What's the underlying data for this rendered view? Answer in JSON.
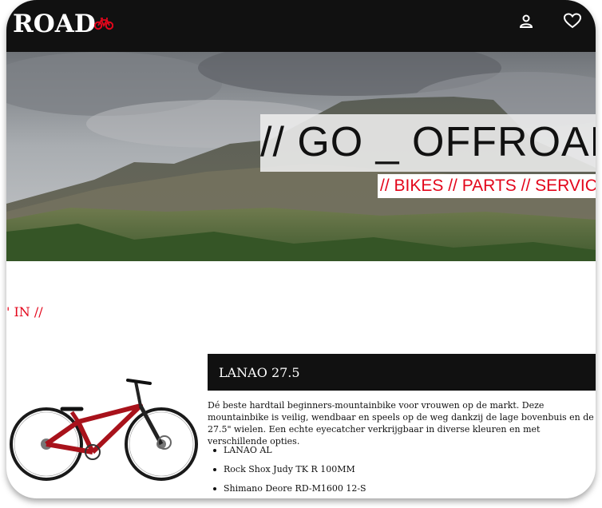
{
  "header": {
    "brand": "ROAD",
    "icons": [
      "bike-icon",
      "user-icon",
      "heart-icon"
    ]
  },
  "hero": {
    "headline": "// GO _ OFFROAD",
    "subline": "// BIKES // PARTS // SERVIC"
  },
  "section": {
    "label": "' IN //"
  },
  "product": {
    "title": "LANAO 27.5",
    "description": "Dé beste hardtail beginners-mountainbike voor vrouwen op de markt. Deze mountainbike is veilig, wendbaar en speels op de weg dankzij de lage bovenbuis en de 27.5\" wielen. Een echte eyecatcher verkrijgbaar in diverse kleuren en met verschillende opties.",
    "specs": [
      "LANAO AL",
      "Rock Shox Judy TK R 100MM",
      "Shimano Deore RD-M1600 12-S"
    ]
  },
  "colors": {
    "accent": "#e3061b",
    "dark": "#111111"
  }
}
